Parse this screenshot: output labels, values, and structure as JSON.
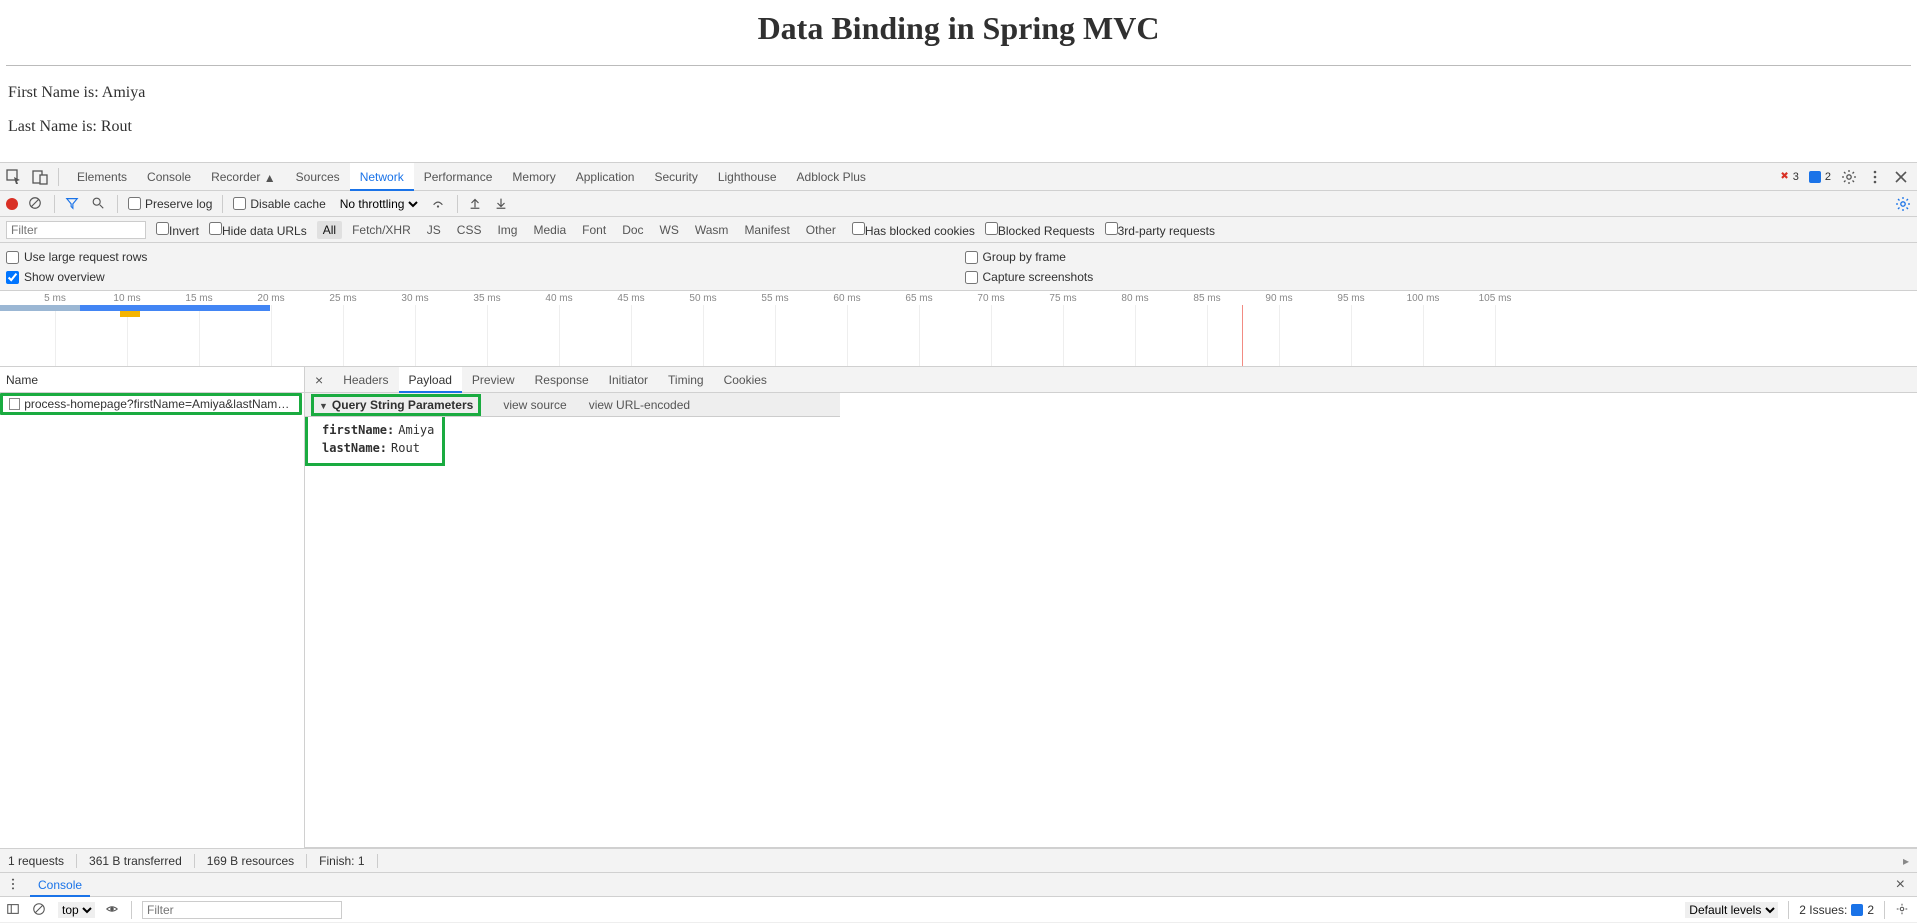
{
  "page": {
    "title": "Data Binding in Spring MVC",
    "line1_label": "First Name is: ",
    "line1_value": "Amiya",
    "line2_label": "Last Name is: ",
    "line2_value": "Rout"
  },
  "devtools": {
    "tabs": [
      "Elements",
      "Console",
      "Recorder",
      "Sources",
      "Network",
      "Performance",
      "Memory",
      "Application",
      "Security",
      "Lighthouse",
      "Adblock Plus"
    ],
    "active_tab": "Network",
    "errors_count": "3",
    "messages_count": "2"
  },
  "network_toolbar": {
    "preserve_log": "Preserve log",
    "disable_cache": "Disable cache",
    "throttling": "No throttling"
  },
  "filter_bar": {
    "filter_placeholder": "Filter",
    "invert": "Invert",
    "hide_data_urls": "Hide data URLs",
    "chips": [
      "All",
      "Fetch/XHR",
      "JS",
      "CSS",
      "Img",
      "Media",
      "Font",
      "Doc",
      "WS",
      "Wasm",
      "Manifest",
      "Other"
    ],
    "active_chip": "All",
    "has_blocked_cookies": "Has blocked cookies",
    "blocked_requests": "Blocked Requests",
    "third_party": "3rd-party requests"
  },
  "options": {
    "use_large_rows": "Use large request rows",
    "show_overview": "Show overview",
    "group_by_frame": "Group by frame",
    "capture_screenshots": "Capture screenshots"
  },
  "timeline": {
    "ticks": [
      "5 ms",
      "10 ms",
      "15 ms",
      "20 ms",
      "25 ms",
      "30 ms",
      "35 ms",
      "40 ms",
      "45 ms",
      "50 ms",
      "55 ms",
      "60 ms",
      "65 ms",
      "70 ms",
      "75 ms",
      "80 ms",
      "85 ms",
      "90 ms",
      "95 ms",
      "100 ms",
      "105 ms"
    ]
  },
  "request_list": {
    "header": "Name",
    "rows": [
      "process-homepage?firstName=Amiya&lastName=Rout"
    ]
  },
  "detail": {
    "tabs": [
      "Headers",
      "Payload",
      "Preview",
      "Response",
      "Initiator",
      "Timing",
      "Cookies"
    ],
    "active_tab": "Payload",
    "section_title": "Query String Parameters",
    "view_source": "view source",
    "view_url_encoded": "view URL-encoded",
    "params": [
      {
        "key": "firstName:",
        "value": "Amiya"
      },
      {
        "key": "lastName:",
        "value": "Rout"
      }
    ]
  },
  "status": {
    "requests": "1 requests",
    "transferred": "361 B transferred",
    "resources": "169 B resources",
    "finish": "Finish: 1"
  },
  "console": {
    "tab_label": "Console",
    "context": "top",
    "filter_placeholder": "Filter",
    "levels": "Default levels",
    "issues_label": "2 Issues:",
    "issues_count": "2"
  }
}
